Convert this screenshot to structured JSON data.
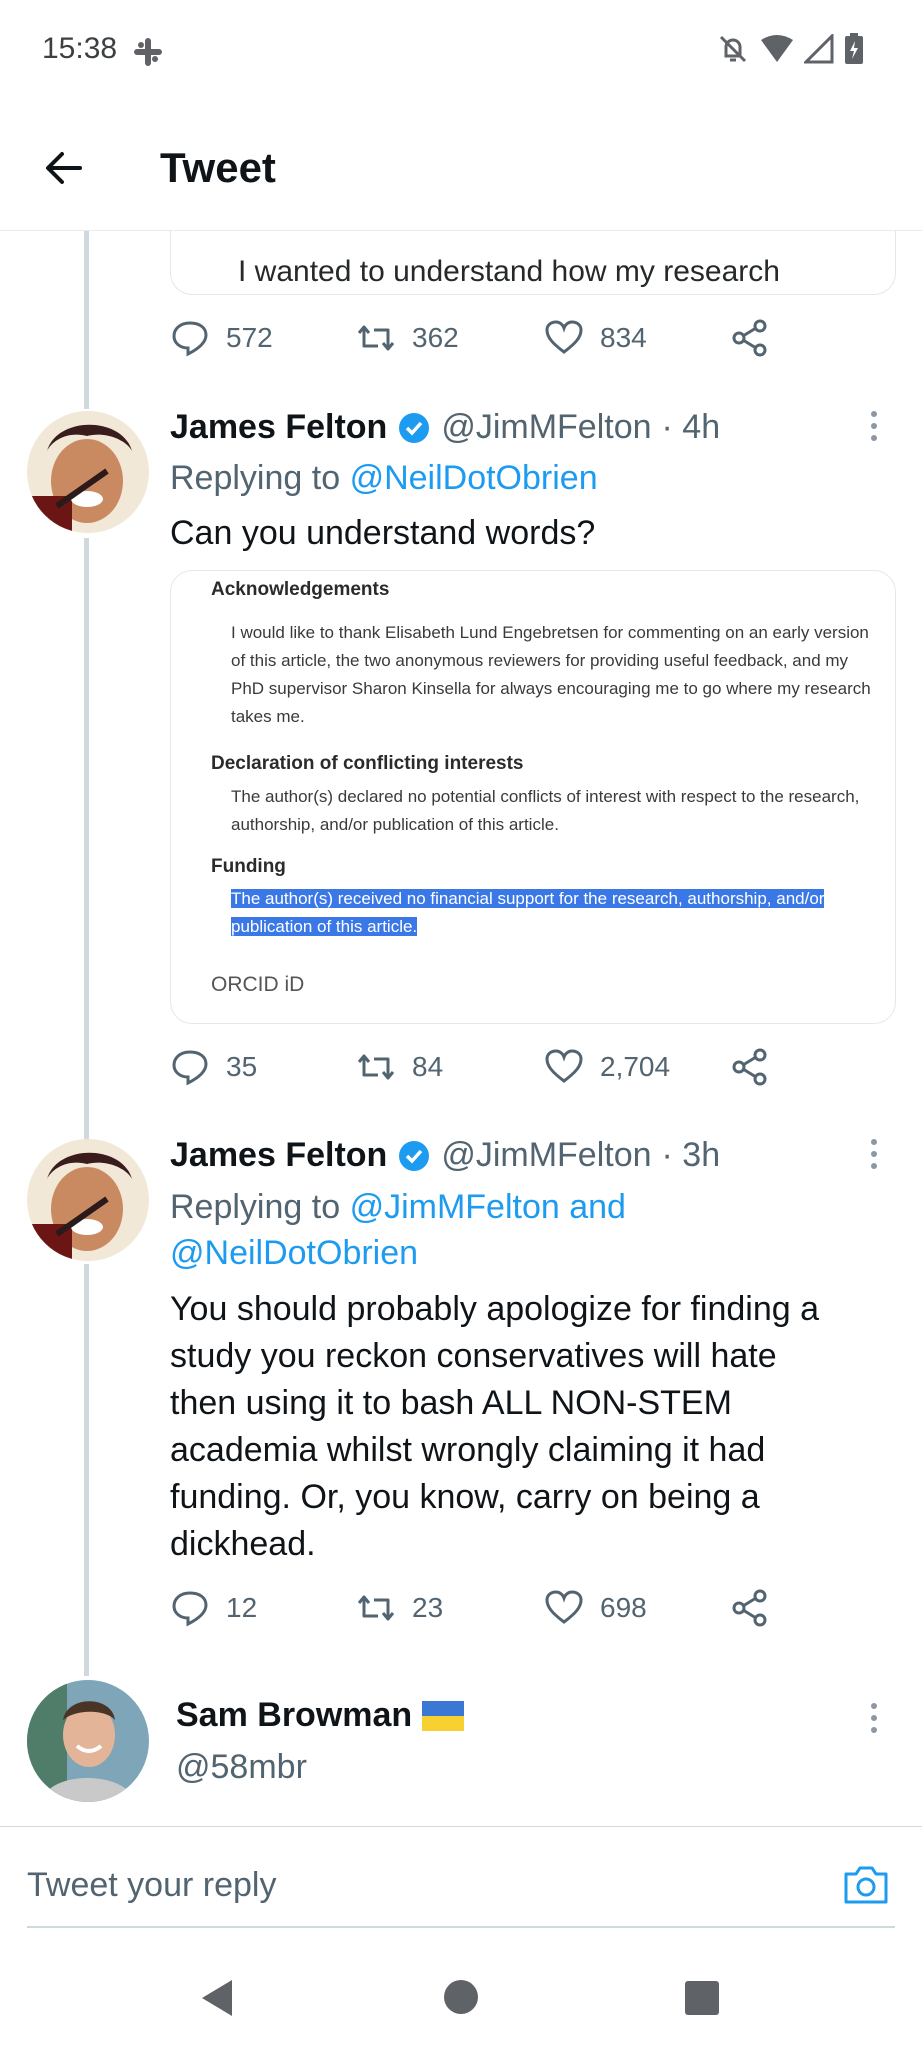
{
  "status_bar": {
    "time": "15:38"
  },
  "header": {
    "title": "Tweet"
  },
  "quoted_snippet": {
    "text": "I wanted to understand how my research"
  },
  "tweet0_actions": {
    "replies": "572",
    "retweets": "362",
    "likes": "834"
  },
  "tweet1": {
    "name": "James Felton",
    "handle": "@JimMFelton",
    "time": "· 4h",
    "replying_prefix": "Replying to",
    "replying_to": "@NeilDotObrien",
    "text": "Can you understand words?",
    "image": {
      "ack_heading": "Acknowledgements",
      "ack_lines": [
        "I would like to thank Elisabeth Lund Engebretsen for commenting on an early version",
        "of this article, the two anonymous reviewers for providing useful feedback, and my",
        "PhD supervisor Sharon Kinsella for always encouraging me to go where my research",
        "takes me."
      ],
      "coi_heading": "Declaration of conflicting interests",
      "coi_lines": [
        "The author(s) declared no potential conflicts of interest with respect to the research,",
        "authorship, and/or publication of this article."
      ],
      "funding_heading": "Funding",
      "funding_lines": [
        "The author(s) received no financial support for the research, authorship, and/or",
        "publication of this article."
      ],
      "orcid": "ORCID iD"
    },
    "actions": {
      "replies": "35",
      "retweets": "84",
      "likes": "2,704"
    }
  },
  "tweet2": {
    "name": "James Felton",
    "handle": "@JimMFelton",
    "time": "· 3h",
    "replying_prefix": "Replying to",
    "replying_to_1": "@JimMFelton and",
    "replying_to_2": "@NeilDotObrien",
    "text_lines": [
      "You should probably apologize for finding a",
      "study you reckon conservatives will hate",
      "then using it to bash ALL NON-STEM",
      "academia whilst wrongly claiming it had",
      "funding. Or, you know, carry on being a",
      "dickhead."
    ],
    "actions": {
      "replies": "12",
      "retweets": "23",
      "likes": "698"
    }
  },
  "tweet3": {
    "name": "Sam Browman",
    "handle": "@58mbr",
    "flag": "ukraine-flag"
  },
  "reply_bar": {
    "placeholder": "Tweet your reply"
  },
  "colors": {
    "accent": "#1d9bf0",
    "verified": "#1d9bf0",
    "highlight": "#3b78e7",
    "muted": "#536471"
  }
}
